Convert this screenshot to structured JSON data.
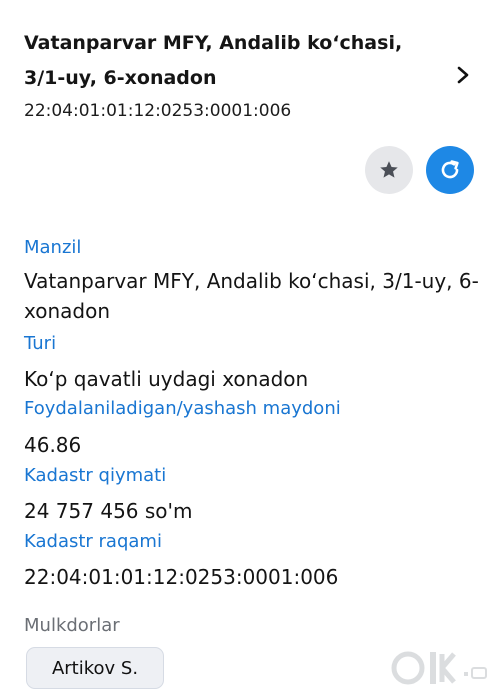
{
  "header": {
    "title": "Vatanparvar MFY, Andalib ko‘chasi, 3/1-uy, 6-xonadon",
    "cadastral_code": "22:04:01:01:12:0253:0001:006"
  },
  "actions": {
    "favorite_icon": "star-icon",
    "refresh_icon": "refresh-icon",
    "accent_color": "#1e88e5"
  },
  "details": [
    {
      "label": "Manzil",
      "value": "Vatanparvar MFY, Andalib ko‘chasi, 3/1-uy, 6-xonadon"
    },
    {
      "label": "Turi",
      "value": "Ko‘p qavatli uydagi xonadon"
    },
    {
      "label": "Foydalaniladigan/yashash maydoni",
      "value": "46.86"
    },
    {
      "label": "Kadastr qiymati",
      "value": "24 757 456 so'm"
    },
    {
      "label": "Kadastr raqami",
      "value": "22:04:01:01:12:0253:0001:006"
    }
  ],
  "owners": {
    "label": "Mulkdorlar",
    "items": [
      "Artikov S."
    ]
  }
}
